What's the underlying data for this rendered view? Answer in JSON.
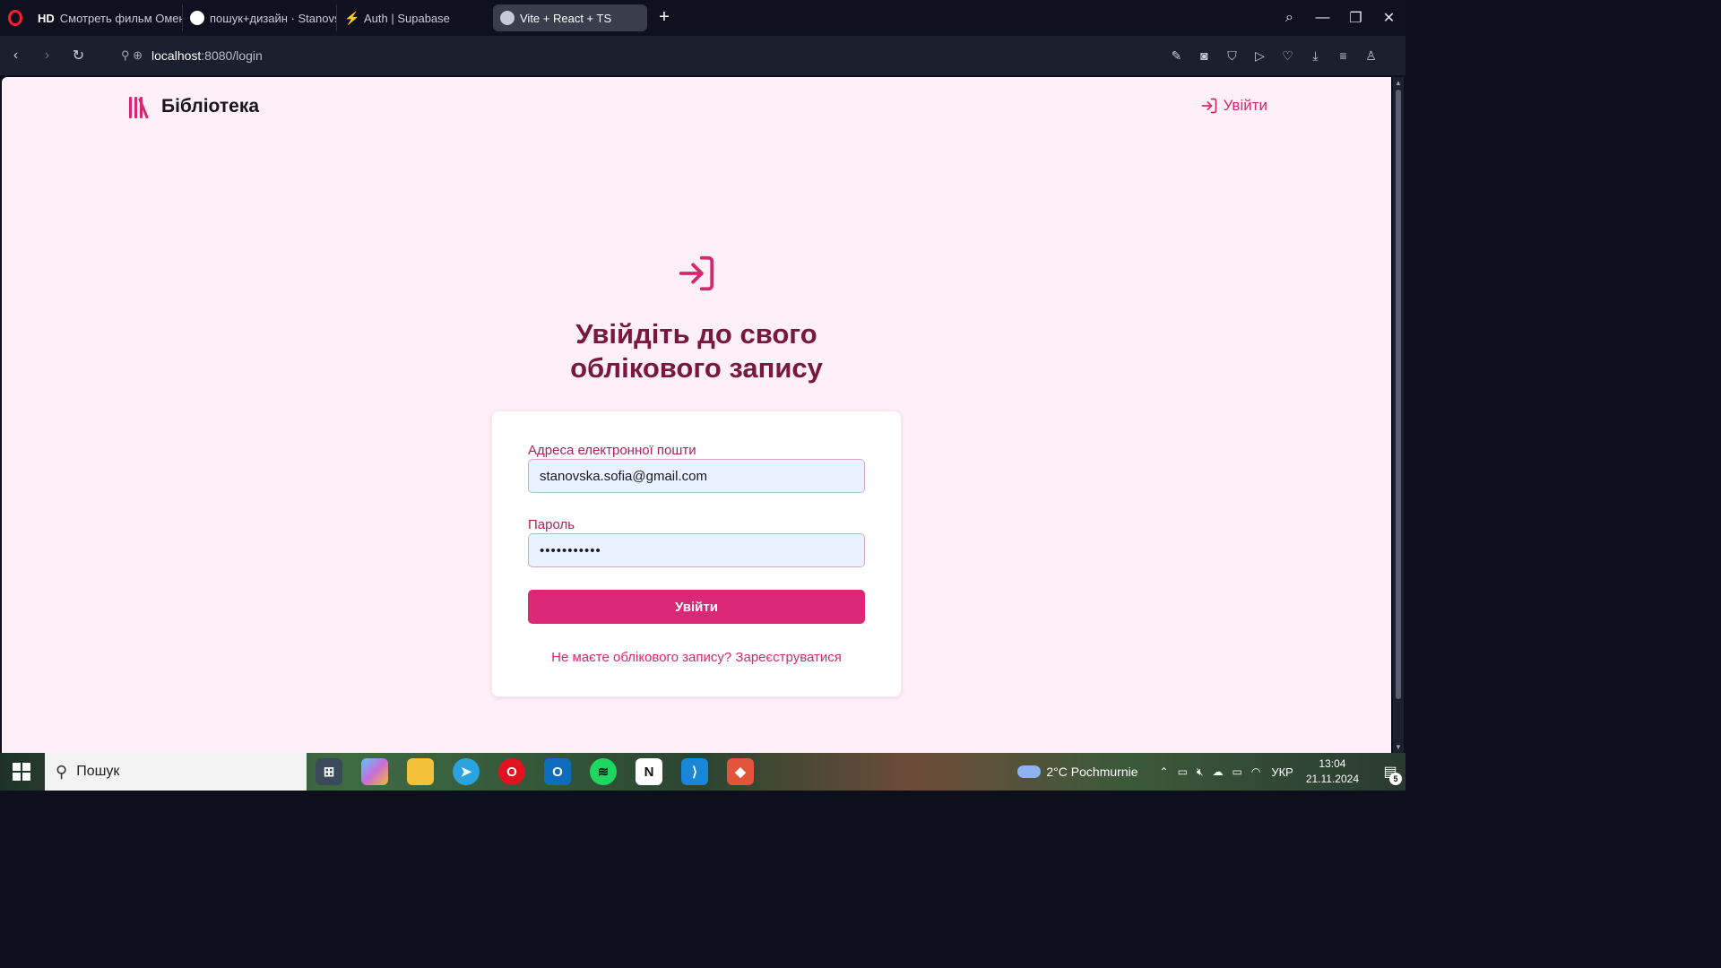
{
  "browser": {
    "tabs": [
      {
        "label": "Смотреть фильм Омен о",
        "badge": "HD"
      },
      {
        "label": "пошук+дизайн · Stanovsk"
      },
      {
        "label": "Auth | Supabase"
      },
      {
        "label": "Vite + React + TS",
        "active": true
      }
    ],
    "new_tab_symbol": "+",
    "address": {
      "host": "localhost",
      "path": ":8080/login"
    }
  },
  "app": {
    "brand_name": "Бібліотека",
    "header_login_label": "Увійти",
    "title_line1": "Увійдіть до свого",
    "title_line2": "облікового запису",
    "email_label": "Адреса електронної пошти",
    "email_value": "stanovska.sofia@gmail.com",
    "password_label": "Пароль",
    "password_value": "•••••••••••",
    "submit_label": "Увійти",
    "register_text": "Не маєте облікового запису? Зареєструватися",
    "accent_color": "#da2877",
    "title_color": "#7a1741"
  },
  "taskbar": {
    "search_placeholder": "Пошук",
    "weather": "2°C  Pochmurnie",
    "language": "УКР",
    "time": "13:04",
    "date": "21.11.2024",
    "notifications": "5",
    "apps": [
      "notes-icon",
      "bluestacks-icon",
      "widgets-icon",
      "copilot-icon",
      "file-explorer-icon",
      "telegram-icon",
      "opera-icon",
      "outlook-icon",
      "spotify-icon",
      "notion-icon",
      "vscode-icon",
      "git-icon"
    ]
  }
}
